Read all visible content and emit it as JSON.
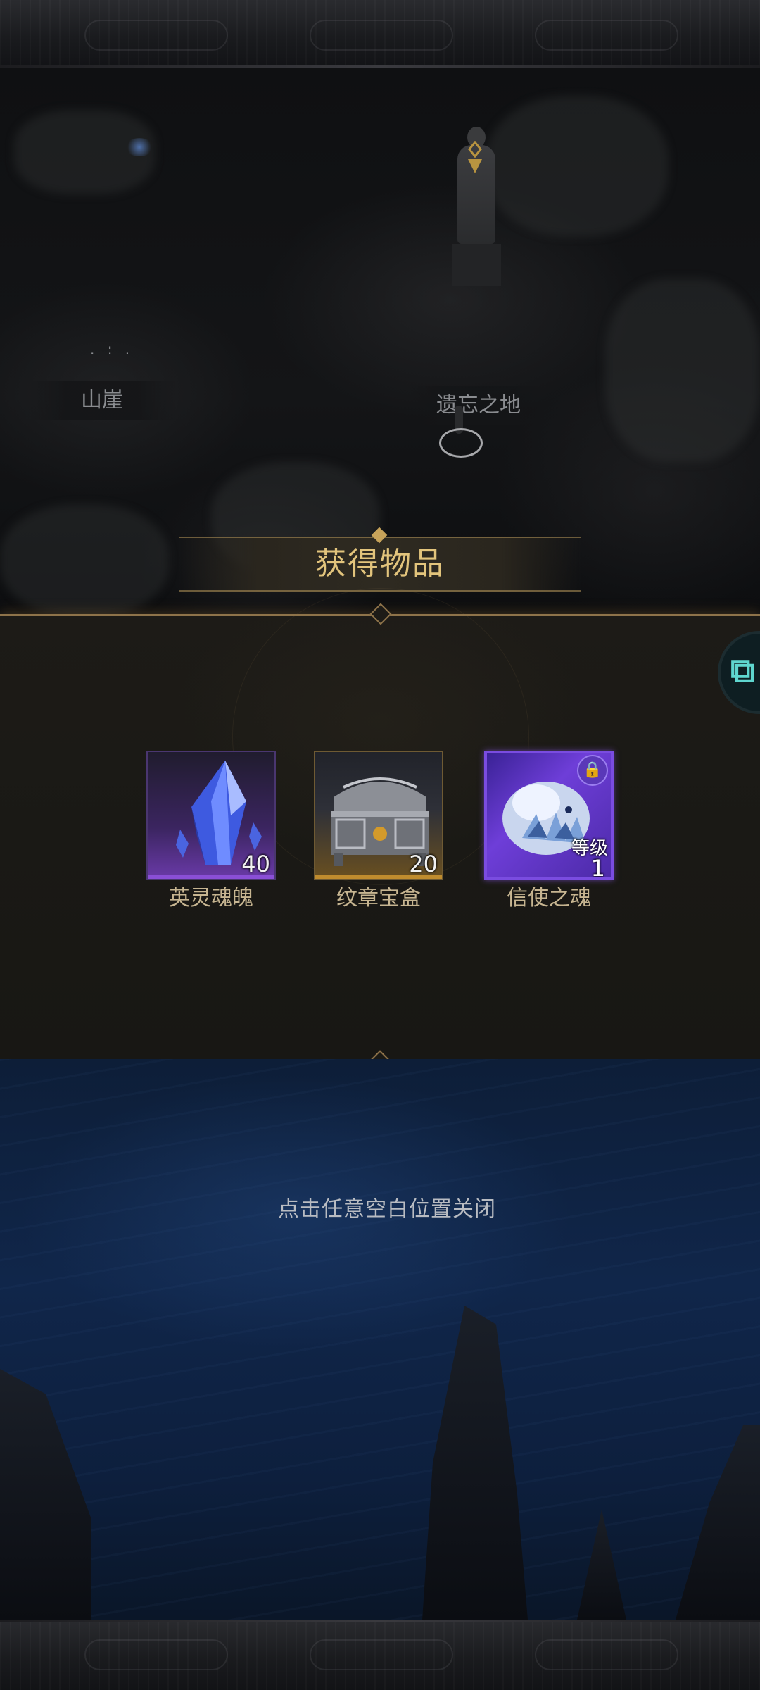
{
  "map": {
    "labels": {
      "cliff": "山崖",
      "relic_land": "遗忘之地"
    },
    "icons": [
      "waypoint-marker-icon",
      "statue-icon",
      "location-ring-icon"
    ]
  },
  "dialog": {
    "title": "获得物品",
    "items": [
      {
        "name": "英灵魂魄",
        "count": "40",
        "icon": "soul-crystal-icon",
        "rarity_color": "#8a4fd6"
      },
      {
        "name": "纹章宝盒",
        "count": "20",
        "icon": "crest-chest-icon",
        "rarity_color": "#c08c2e"
      },
      {
        "name": "信使之魂",
        "level_label": "等级",
        "level": "1",
        "icon": "messenger-beast-icon",
        "badge_icon": "lock-badge-icon",
        "rarity_color": "#7a4ce0"
      }
    ],
    "close_hint": "点击任意空白位置关闭"
  },
  "colors": {
    "title_gold": "#e2c47c",
    "item_name": "#c7b591",
    "panel_border": "#8e734a",
    "float_button": "#5fd6cf"
  }
}
